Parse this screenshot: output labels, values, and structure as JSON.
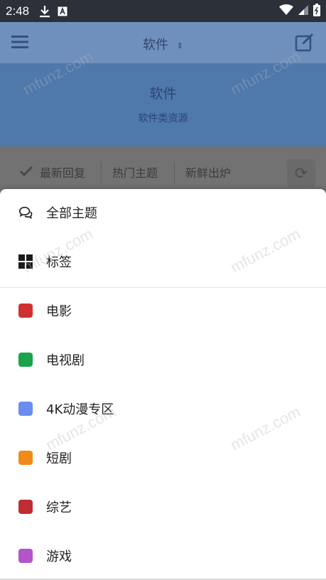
{
  "status_bar": {
    "time": "2:48"
  },
  "header": {
    "title": "软件"
  },
  "hero": {
    "title": "软件",
    "subtitle": "软件类资源"
  },
  "tabs": [
    {
      "label": "最新回复"
    },
    {
      "label": "热门主题"
    },
    {
      "label": "新鲜出炉"
    }
  ],
  "sheet": {
    "items": [
      {
        "label": "全部主题",
        "icon": "chat-bubbles-icon"
      },
      {
        "label": "标签",
        "icon": "grid-icon"
      },
      {
        "label": "电影",
        "color": "#d0302f"
      },
      {
        "label": "电视剧",
        "color": "#1aa34a"
      },
      {
        "label": "4K动漫专区",
        "color": "#6a8ef0"
      },
      {
        "label": "短剧",
        "color": "#f08a18"
      },
      {
        "label": "综艺",
        "color": "#bf2d33"
      },
      {
        "label": "游戏",
        "color": "#b455c9"
      }
    ]
  },
  "watermark": "mfunz.com"
}
